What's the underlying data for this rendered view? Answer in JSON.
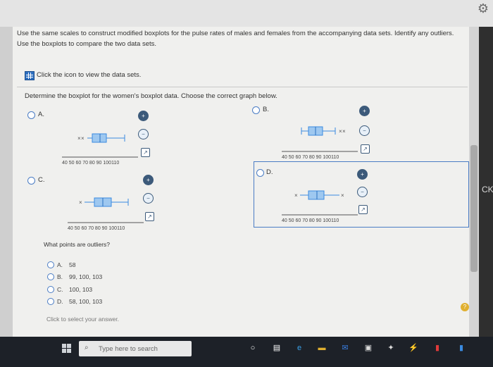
{
  "header": {
    "settings_icon": "gear-icon"
  },
  "instructions": {
    "line1": "Use the same scales to construct modified boxplots for the pulse rates of males and females from the accompanying data sets. Identify any outliers.",
    "line2": "Use the boxplots to compare the two data sets."
  },
  "data_link": {
    "label": "Click the icon to view the data sets.",
    "icon": "table-icon"
  },
  "question": "Determine the boxplot for the women's boxplot data. Choose the correct graph below.",
  "options": [
    {
      "label": "A."
    },
    {
      "label": "B."
    },
    {
      "label": "C."
    },
    {
      "label": "D."
    }
  ],
  "axis_ticks": "40 50 60 70 80 90 100110",
  "selected_option": "D.",
  "outlier_question": "What points are outliers?",
  "outlier_answers": [
    {
      "letter": "A.",
      "text": "58"
    },
    {
      "letter": "B.",
      "text": "99, 100, 103"
    },
    {
      "letter": "C.",
      "text": "100, 103"
    },
    {
      "letter": "D.",
      "text": "58, 100, 103"
    }
  ],
  "hint": "Click to select your answer.",
  "help_badge": "?",
  "taskbar": {
    "search_placeholder": "Type here to search"
  },
  "colors": {
    "accent": "#4a7cc4",
    "box_fill": "#3a8ae0",
    "taskbar": "#1d2128"
  },
  "side_text": "CK"
}
